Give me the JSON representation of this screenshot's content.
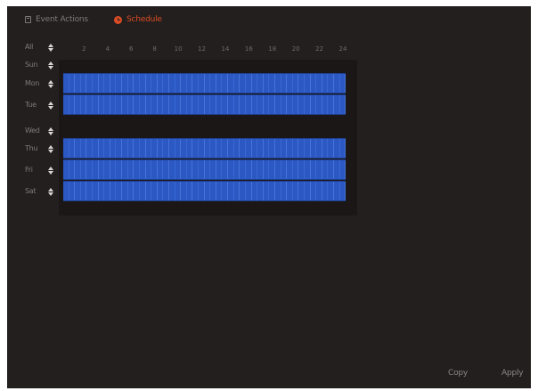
{
  "tabs": {
    "event_actions": "Event Actions",
    "schedule": "Schedule"
  },
  "colors": {
    "active_tab": "#d94b24",
    "scheduled_slot": "#2b58c2",
    "background": "#231f1e"
  },
  "hours": [
    "2",
    "4",
    "6",
    "8",
    "10",
    "12",
    "14",
    "16",
    "18",
    "20",
    "22",
    "24"
  ],
  "days": [
    {
      "label": "All",
      "key": "all"
    },
    {
      "label": "Sun",
      "key": "sun",
      "scheduled": false
    },
    {
      "label": "Mon",
      "key": "mon",
      "scheduled": true
    },
    {
      "label": "Tue",
      "key": "tue",
      "scheduled": true
    },
    {
      "label": "Wed",
      "key": "wed",
      "scheduled": false
    },
    {
      "label": "Thu",
      "key": "thu",
      "scheduled": true
    },
    {
      "label": "Fri",
      "key": "fri",
      "scheduled": true
    },
    {
      "label": "Sat",
      "key": "sat",
      "scheduled": true
    }
  ],
  "slots_per_day": 48,
  "buttons": {
    "copy": "Copy",
    "apply": "Apply"
  },
  "icons": {
    "event_actions": "event-list-icon",
    "schedule": "clock-icon",
    "toggle": "up-down-arrows-icon"
  }
}
